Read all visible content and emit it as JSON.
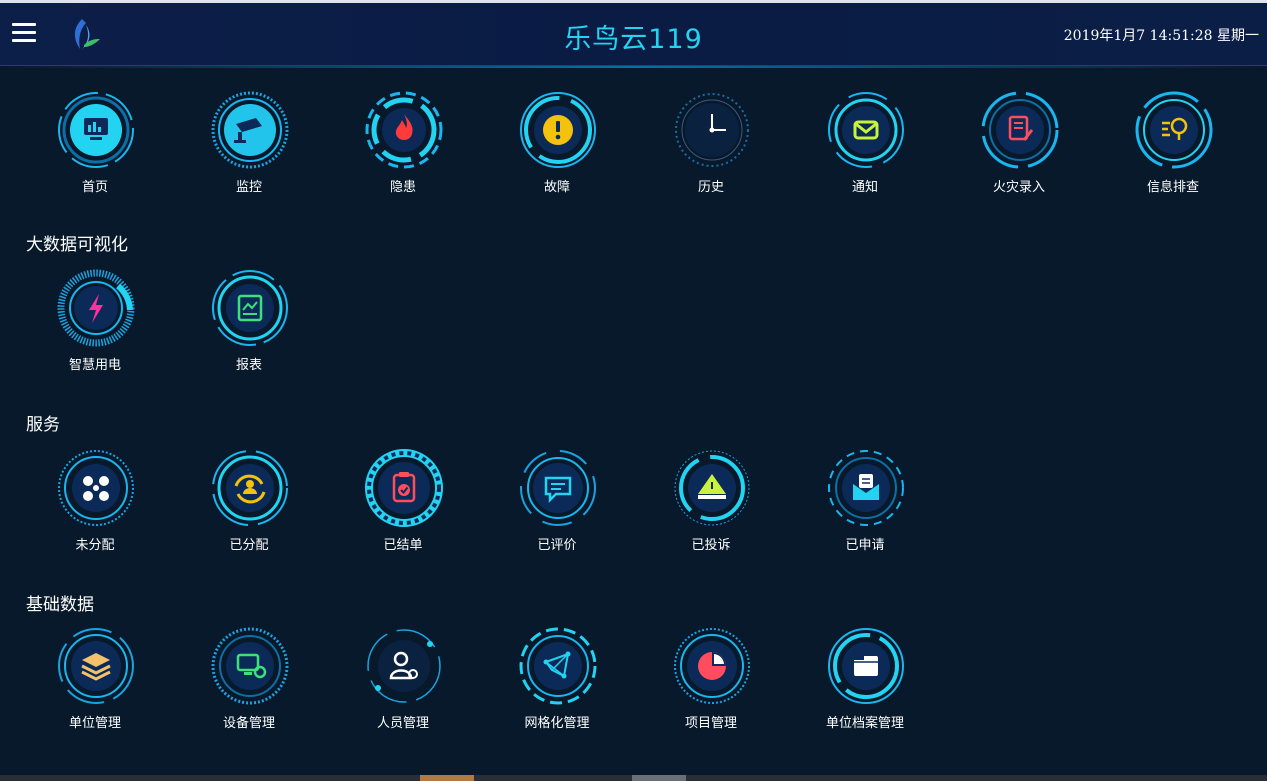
{
  "header": {
    "title": "乐鸟云119",
    "datetime": "2019年1月7 14:51:28 星期一"
  },
  "colors": {
    "accent": "#22d3f2",
    "ring": "#1aa3e0",
    "background": "#07192b"
  },
  "sections": {
    "bigdata": "大数据可视化",
    "service": "服务",
    "basic": "基础数据"
  },
  "top": [
    {
      "label": "首页",
      "icon": "monitor-chart-icon"
    },
    {
      "label": "监控",
      "icon": "camera-icon"
    },
    {
      "label": "隐患",
      "icon": "fire-icon"
    },
    {
      "label": "故障",
      "icon": "exclamation-icon"
    },
    {
      "label": "历史",
      "icon": "clock-icon"
    },
    {
      "label": "通知",
      "icon": "mail-icon"
    },
    {
      "label": "火灾录入",
      "icon": "document-pen-icon"
    },
    {
      "label": "信息排查",
      "icon": "search-list-icon"
    }
  ],
  "bigdata": [
    {
      "label": "智慧用电",
      "icon": "lightning-icon"
    },
    {
      "label": "报表",
      "icon": "report-icon"
    }
  ],
  "service": [
    {
      "label": "未分配",
      "icon": "network-nodes-icon"
    },
    {
      "label": "已分配",
      "icon": "assign-user-icon"
    },
    {
      "label": "已结单",
      "icon": "clipboard-check-icon"
    },
    {
      "label": "已评价",
      "icon": "message-icon"
    },
    {
      "label": "已投诉",
      "icon": "warning-tray-icon"
    },
    {
      "label": "已申请",
      "icon": "mail-open-icon"
    }
  ],
  "basic": [
    {
      "label": "单位管理",
      "icon": "layers-icon"
    },
    {
      "label": "设备管理",
      "icon": "computer-gear-icon"
    },
    {
      "label": "人员管理",
      "icon": "user-gear-icon"
    },
    {
      "label": "网格化管理",
      "icon": "grid-network-icon"
    },
    {
      "label": "项目管理",
      "icon": "pie-chart-icon"
    },
    {
      "label": "单位档案管理",
      "icon": "folder-icon"
    }
  ]
}
